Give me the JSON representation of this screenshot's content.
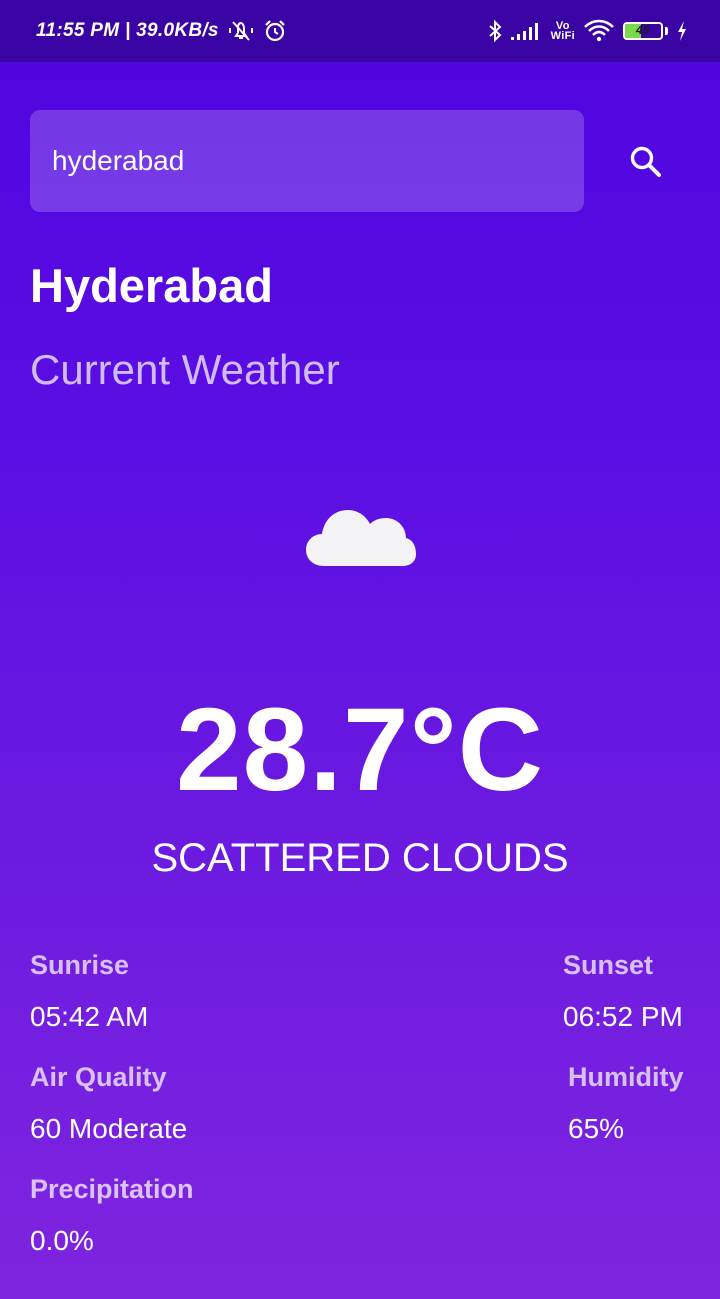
{
  "status_bar": {
    "time_speed": "11:55 PM | 39.0KB/s",
    "vowifi_top": "Vo",
    "vowifi_bottom": "WiFi",
    "battery_level": "45",
    "battery_percent": 45
  },
  "search": {
    "value": "hyderabad",
    "icon": "search-icon"
  },
  "location": {
    "city": "Hyderabad",
    "subtitle": "Current Weather"
  },
  "weather": {
    "icon": "cloud-icon",
    "temperature": "28.7°C",
    "description": "SCATTERED CLOUDS"
  },
  "details": {
    "sunrise": {
      "label": "Sunrise",
      "value": "05:42 AM"
    },
    "sunset": {
      "label": "Sunset",
      "value": "06:52 PM"
    },
    "air_quality": {
      "label": "Air Quality",
      "value": "60 Moderate"
    },
    "humidity": {
      "label": "Humidity",
      "value": "65%"
    },
    "precipitation": {
      "label": "Precipitation",
      "value": "0.0%"
    }
  },
  "colors": {
    "gradient_top": "#4f04e0",
    "gradient_bottom": "#7e24df",
    "status_bar": "#3a03a3",
    "battery_fill": "#7bd94c"
  }
}
